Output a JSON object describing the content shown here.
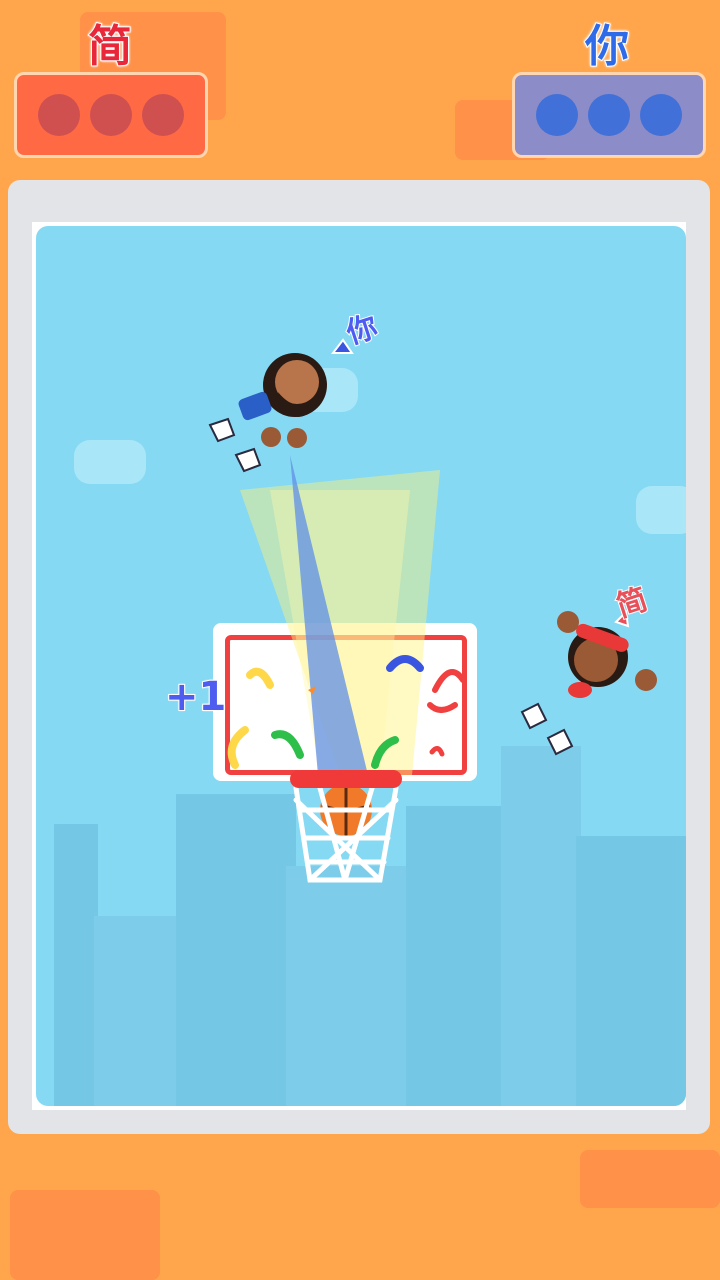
{
  "players": {
    "left": {
      "name": "简",
      "name_color": "#E8283A",
      "panel_color": "#FF6A45",
      "dot_color": "#D05050",
      "dots": 3
    },
    "right": {
      "name": "你",
      "name_color": "#2F6BE8",
      "panel_color": "#8C8CC8",
      "dot_color": "#4070D8",
      "dots": 3
    }
  },
  "court": {
    "you_tag": "你",
    "opponent_tag": "简",
    "score_popup": "+1"
  },
  "colors": {
    "background": "#FFA64D",
    "court": "#86D9F2",
    "rim": "#F03A3A",
    "you_accent": "#4F5CF0",
    "opponent_accent": "#E8505A"
  }
}
